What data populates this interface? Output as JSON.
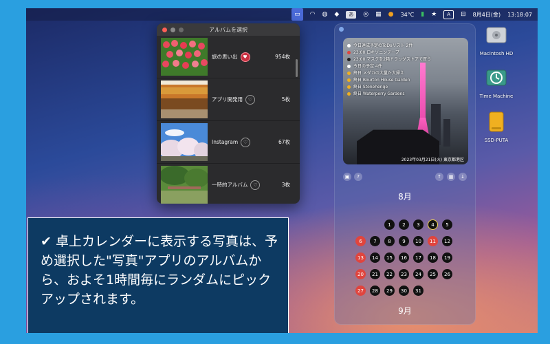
{
  "menubar": {
    "badge": "あ",
    "temp": "34°C",
    "ime": "A",
    "date": "8月4日(金)",
    "time": "13:18:07"
  },
  "album_window": {
    "title": "アルバムを選択",
    "albums": [
      {
        "name": "旅の思い出",
        "count": "954枚",
        "selected": true
      },
      {
        "name": "アプリ開発用",
        "count": "5枚",
        "selected": false
      },
      {
        "name": "Instagram",
        "count": "67枚",
        "selected": false
      },
      {
        "name": "一時的アルバム",
        "count": "3枚",
        "selected": false
      }
    ]
  },
  "widget": {
    "overlay": [
      {
        "text": "今日達成予定のToDoリスト 2件",
        "color": "#ffffff"
      },
      {
        "text": "23:00 ロキソニンテープ",
        "color": "#e0453e"
      },
      {
        "text": "23:00 マスクを2箱ドラッグストアで買う",
        "color": "#222222"
      },
      {
        "text": "今日の予定 4件",
        "color": "#ffffff"
      },
      {
        "text": "終日 メダカの大量た大掃え",
        "color": "#f0b020"
      },
      {
        "text": "終日 Bourton House Garden",
        "color": "#f0b020"
      },
      {
        "text": "終日 Stonehenge",
        "color": "#f0b020"
      },
      {
        "text": "終日 Waterperry Gardens",
        "color": "#f0b020"
      }
    ],
    "photo_caption": "2023年03月21日(火) 東京都港区",
    "month": "8月",
    "next_month": "9月",
    "weeks": [
      [
        null,
        null,
        "1",
        "2",
        "3",
        "4",
        "5"
      ],
      [
        "6",
        "7",
        "8",
        "9",
        "10",
        "11",
        "12"
      ],
      [
        "13",
        "14",
        "15",
        "16",
        "17",
        "18",
        "19"
      ],
      [
        "20",
        "21",
        "22",
        "23",
        "24",
        "25",
        "26"
      ],
      [
        "27",
        "28",
        "29",
        "30",
        "31",
        null,
        null
      ]
    ],
    "holidays": [
      "6",
      "11",
      "13",
      "20",
      "27"
    ],
    "today": "4"
  },
  "desktop": {
    "icons": [
      {
        "label": "Macintosh HD",
        "icon": "hard-drive-icon"
      },
      {
        "label": "Time Machine",
        "icon": "time-machine-icon"
      },
      {
        "label": "SSD-PUTA",
        "icon": "external-drive-icon"
      }
    ]
  },
  "caption": {
    "check": "✔",
    "text": "卓上カレンダーに表示する写真は、予め選択した\"写真\"アプリのアルバムから、およそ1時間毎にランダムにピックアップされます。"
  }
}
